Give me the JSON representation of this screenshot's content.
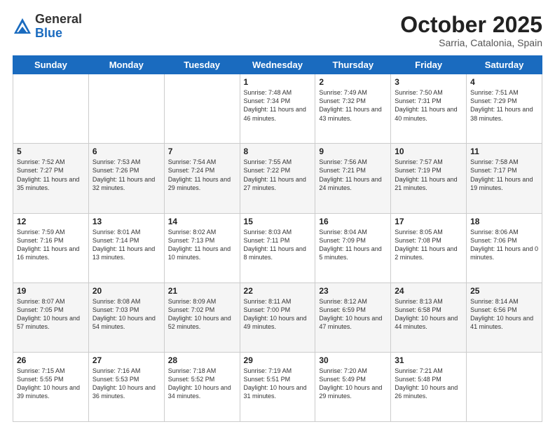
{
  "logo": {
    "general": "General",
    "blue": "Blue"
  },
  "title": {
    "month": "October 2025",
    "location": "Sarria, Catalonia, Spain"
  },
  "weekdays": [
    "Sunday",
    "Monday",
    "Tuesday",
    "Wednesday",
    "Thursday",
    "Friday",
    "Saturday"
  ],
  "weeks": [
    [
      {
        "day": "",
        "info": ""
      },
      {
        "day": "",
        "info": ""
      },
      {
        "day": "",
        "info": ""
      },
      {
        "day": "1",
        "info": "Sunrise: 7:48 AM\nSunset: 7:34 PM\nDaylight: 11 hours and 46 minutes."
      },
      {
        "day": "2",
        "info": "Sunrise: 7:49 AM\nSunset: 7:32 PM\nDaylight: 11 hours and 43 minutes."
      },
      {
        "day": "3",
        "info": "Sunrise: 7:50 AM\nSunset: 7:31 PM\nDaylight: 11 hours and 40 minutes."
      },
      {
        "day": "4",
        "info": "Sunrise: 7:51 AM\nSunset: 7:29 PM\nDaylight: 11 hours and 38 minutes."
      }
    ],
    [
      {
        "day": "5",
        "info": "Sunrise: 7:52 AM\nSunset: 7:27 PM\nDaylight: 11 hours and 35 minutes."
      },
      {
        "day": "6",
        "info": "Sunrise: 7:53 AM\nSunset: 7:26 PM\nDaylight: 11 hours and 32 minutes."
      },
      {
        "day": "7",
        "info": "Sunrise: 7:54 AM\nSunset: 7:24 PM\nDaylight: 11 hours and 29 minutes."
      },
      {
        "day": "8",
        "info": "Sunrise: 7:55 AM\nSunset: 7:22 PM\nDaylight: 11 hours and 27 minutes."
      },
      {
        "day": "9",
        "info": "Sunrise: 7:56 AM\nSunset: 7:21 PM\nDaylight: 11 hours and 24 minutes."
      },
      {
        "day": "10",
        "info": "Sunrise: 7:57 AM\nSunset: 7:19 PM\nDaylight: 11 hours and 21 minutes."
      },
      {
        "day": "11",
        "info": "Sunrise: 7:58 AM\nSunset: 7:17 PM\nDaylight: 11 hours and 19 minutes."
      }
    ],
    [
      {
        "day": "12",
        "info": "Sunrise: 7:59 AM\nSunset: 7:16 PM\nDaylight: 11 hours and 16 minutes."
      },
      {
        "day": "13",
        "info": "Sunrise: 8:01 AM\nSunset: 7:14 PM\nDaylight: 11 hours and 13 minutes."
      },
      {
        "day": "14",
        "info": "Sunrise: 8:02 AM\nSunset: 7:13 PM\nDaylight: 11 hours and 10 minutes."
      },
      {
        "day": "15",
        "info": "Sunrise: 8:03 AM\nSunset: 7:11 PM\nDaylight: 11 hours and 8 minutes."
      },
      {
        "day": "16",
        "info": "Sunrise: 8:04 AM\nSunset: 7:09 PM\nDaylight: 11 hours and 5 minutes."
      },
      {
        "day": "17",
        "info": "Sunrise: 8:05 AM\nSunset: 7:08 PM\nDaylight: 11 hours and 2 minutes."
      },
      {
        "day": "18",
        "info": "Sunrise: 8:06 AM\nSunset: 7:06 PM\nDaylight: 11 hours and 0 minutes."
      }
    ],
    [
      {
        "day": "19",
        "info": "Sunrise: 8:07 AM\nSunset: 7:05 PM\nDaylight: 10 hours and 57 minutes."
      },
      {
        "day": "20",
        "info": "Sunrise: 8:08 AM\nSunset: 7:03 PM\nDaylight: 10 hours and 54 minutes."
      },
      {
        "day": "21",
        "info": "Sunrise: 8:09 AM\nSunset: 7:02 PM\nDaylight: 10 hours and 52 minutes."
      },
      {
        "day": "22",
        "info": "Sunrise: 8:11 AM\nSunset: 7:00 PM\nDaylight: 10 hours and 49 minutes."
      },
      {
        "day": "23",
        "info": "Sunrise: 8:12 AM\nSunset: 6:59 PM\nDaylight: 10 hours and 47 minutes."
      },
      {
        "day": "24",
        "info": "Sunrise: 8:13 AM\nSunset: 6:58 PM\nDaylight: 10 hours and 44 minutes."
      },
      {
        "day": "25",
        "info": "Sunrise: 8:14 AM\nSunset: 6:56 PM\nDaylight: 10 hours and 41 minutes."
      }
    ],
    [
      {
        "day": "26",
        "info": "Sunrise: 7:15 AM\nSunset: 5:55 PM\nDaylight: 10 hours and 39 minutes."
      },
      {
        "day": "27",
        "info": "Sunrise: 7:16 AM\nSunset: 5:53 PM\nDaylight: 10 hours and 36 minutes."
      },
      {
        "day": "28",
        "info": "Sunrise: 7:18 AM\nSunset: 5:52 PM\nDaylight: 10 hours and 34 minutes."
      },
      {
        "day": "29",
        "info": "Sunrise: 7:19 AM\nSunset: 5:51 PM\nDaylight: 10 hours and 31 minutes."
      },
      {
        "day": "30",
        "info": "Sunrise: 7:20 AM\nSunset: 5:49 PM\nDaylight: 10 hours and 29 minutes."
      },
      {
        "day": "31",
        "info": "Sunrise: 7:21 AM\nSunset: 5:48 PM\nDaylight: 10 hours and 26 minutes."
      },
      {
        "day": "",
        "info": ""
      }
    ]
  ]
}
